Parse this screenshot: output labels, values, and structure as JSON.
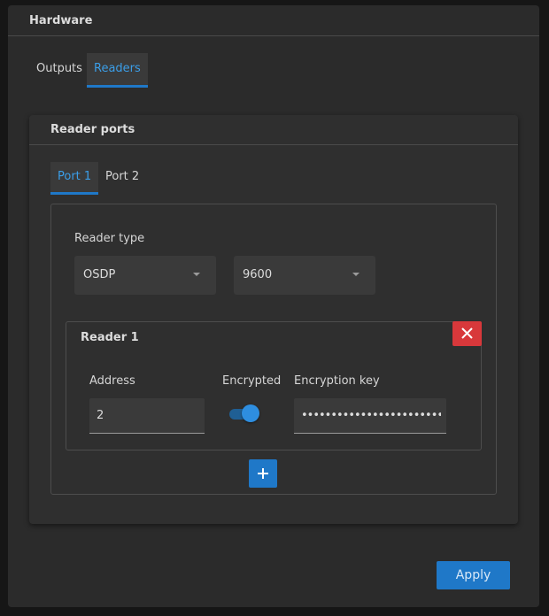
{
  "hardware": {
    "title": "Hardware",
    "tabs": [
      {
        "label": "Outputs",
        "active": false
      },
      {
        "label": "Readers",
        "active": true
      }
    ]
  },
  "reader_ports": {
    "title": "Reader ports",
    "tabs": [
      {
        "label": "Port 1",
        "active": true
      },
      {
        "label": "Port 2",
        "active": false
      }
    ],
    "reader_type_label": "Reader type",
    "reader_type_value": "OSDP",
    "baud_rate_value": "9600",
    "readers": [
      {
        "title": "Reader 1",
        "address_label": "Address",
        "address_value": "2",
        "encrypted_label": "Encrypted",
        "encrypted_on": true,
        "encryption_key_label": "Encryption key",
        "encryption_key_value": "•••••••••••••••••••••••••••••••..."
      }
    ]
  },
  "actions": {
    "apply_label": "Apply"
  },
  "colors": {
    "accent": "#1f78c8",
    "danger": "#d8383b",
    "panel": "#2b2b2b"
  },
  "icons": {
    "remove": "close-icon",
    "add": "plus-icon",
    "dropdown": "chevron-down-icon"
  }
}
